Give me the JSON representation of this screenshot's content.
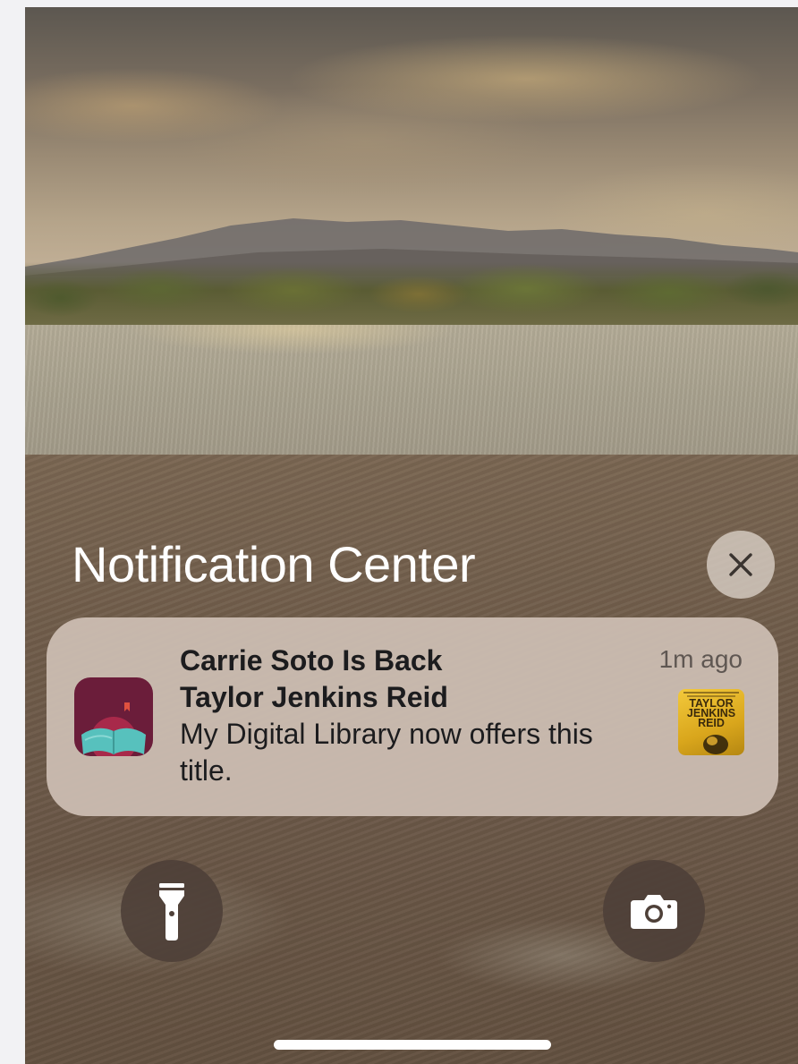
{
  "notification_center": {
    "title": "Notification Center",
    "close_icon": "close-icon"
  },
  "notification": {
    "app_icon": "library-book-reader-icon",
    "title": "Carrie Soto Is Back",
    "subtitle": "Taylor Jenkins Reid",
    "body": "My Digital Library now offers this title.",
    "time": "1m ago",
    "thumbnail": {
      "line1": "TAYLOR",
      "line2": "JENKINS",
      "line3": "REID"
    }
  },
  "quick_actions": {
    "flashlight_icon": "flashlight-icon",
    "camera_icon": "camera-icon"
  },
  "colors": {
    "app_icon_bg": "#6b1d3a",
    "notification_bg": "#cebeb4",
    "action_button_bg": "#4e4038"
  }
}
